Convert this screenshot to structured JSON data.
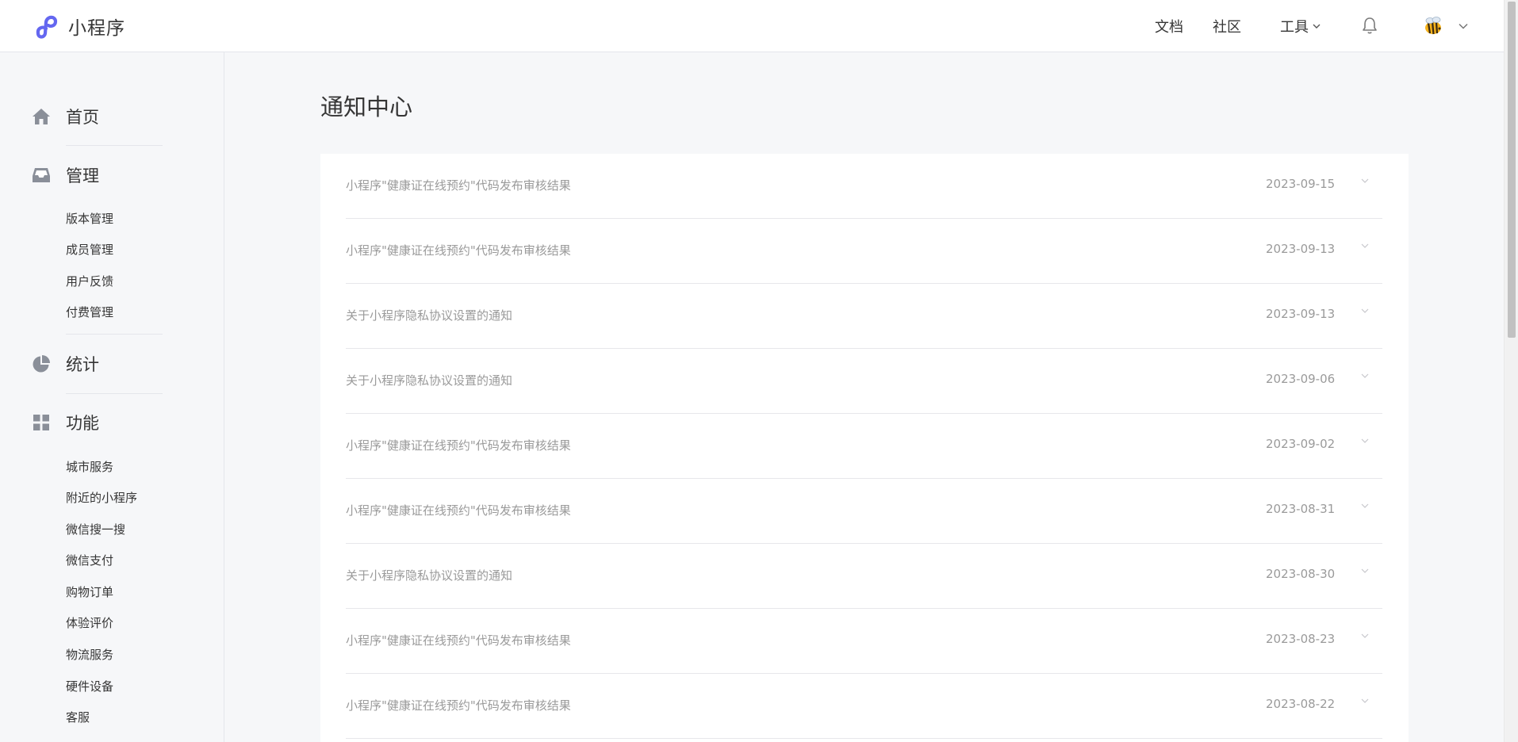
{
  "header": {
    "app_title": "小程序",
    "nav": {
      "docs": "文档",
      "community": "社区",
      "tools": "工具"
    },
    "icons": {
      "logo": "mini-program-logo",
      "notification": "bell-icon",
      "avatar": "bee-avatar",
      "dropdown": "chevron-down-icon"
    }
  },
  "sidebar": {
    "home": "首页",
    "manage": {
      "label": "管理",
      "items": [
        "版本管理",
        "成员管理",
        "用户反馈",
        "付费管理"
      ]
    },
    "stats": "统计",
    "features": {
      "label": "功能",
      "items": [
        "城市服务",
        "附近的小程序",
        "微信搜一搜",
        "微信支付",
        "购物订单",
        "体验评价",
        "物流服务",
        "硬件设备",
        "客服"
      ]
    }
  },
  "main": {
    "title": "通知中心",
    "notifications": [
      {
        "title": "小程序\"健康证在线预约\"代码发布审核结果",
        "date": "2023-09-15"
      },
      {
        "title": "小程序\"健康证在线预约\"代码发布审核结果",
        "date": "2023-09-13"
      },
      {
        "title": "关于小程序隐私协议设置的通知",
        "date": "2023-09-13"
      },
      {
        "title": "关于小程序隐私协议设置的通知",
        "date": "2023-09-06"
      },
      {
        "title": "小程序\"健康证在线预约\"代码发布审核结果",
        "date": "2023-09-02"
      },
      {
        "title": "小程序\"健康证在线预约\"代码发布审核结果",
        "date": "2023-08-31"
      },
      {
        "title": "关于小程序隐私协议设置的通知",
        "date": "2023-08-30"
      },
      {
        "title": "小程序\"健康证在线预约\"代码发布审核结果",
        "date": "2023-08-23"
      },
      {
        "title": "小程序\"健康证在线预约\"代码发布审核结果",
        "date": "2023-08-22"
      }
    ]
  },
  "colors": {
    "brand": "#6467f0",
    "text": "#353535",
    "muted": "#9a9a9a",
    "background": "#f6f7f9"
  }
}
